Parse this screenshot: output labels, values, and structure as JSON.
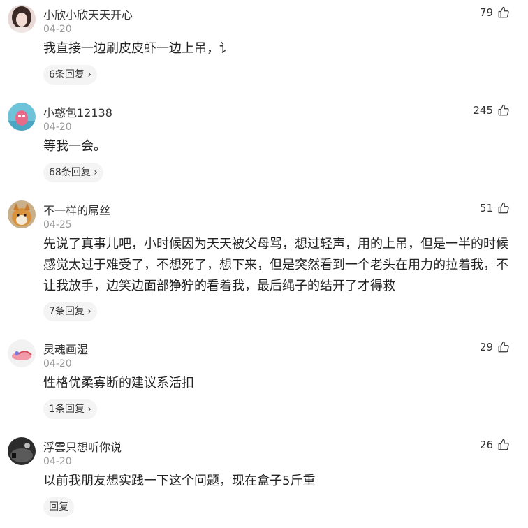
{
  "comments": [
    {
      "username": "小欣小欣天天开心",
      "date": "04-20",
      "likes": "79",
      "text": "我直接一边刷皮皮虾一边上吊，讠",
      "reply_label": "6条回复"
    },
    {
      "username": "小憨包12138",
      "date": "04-20",
      "likes": "245",
      "text": "等我一会。",
      "reply_label": "68条回复"
    },
    {
      "username": "不一样的屌丝",
      "date": "04-25",
      "likes": "51",
      "text": "先说了真事儿吧，小时候因为天天被父母骂，想过轻声，用的上吊，但是一半的时候感觉太过于难受了，不想死了，想下来，但是突然看到一个老头在用力的拉着我，不让我放手，边笑边面部狰狞的看着我，最后绳子的结开了才得救",
      "reply_label": "7条回复"
    },
    {
      "username": "灵魂画湿",
      "date": "04-20",
      "likes": "29",
      "text": "性格优柔寡断的建议系活扣",
      "reply_label": "1条回复"
    },
    {
      "username": "浮雲只想听你说",
      "date": "04-20",
      "likes": "26",
      "text": "以前我朋友想实践一下这个问题，现在盒子5斤重",
      "reply_label": "回复"
    }
  ],
  "icons": {
    "like": "thumbs-up-icon",
    "reply_arrow": "chevron-right-icon"
  },
  "colors": {
    "username": "#333333",
    "date": "#999999",
    "content": "#222222",
    "chip_bg": "#f4f4f4"
  }
}
